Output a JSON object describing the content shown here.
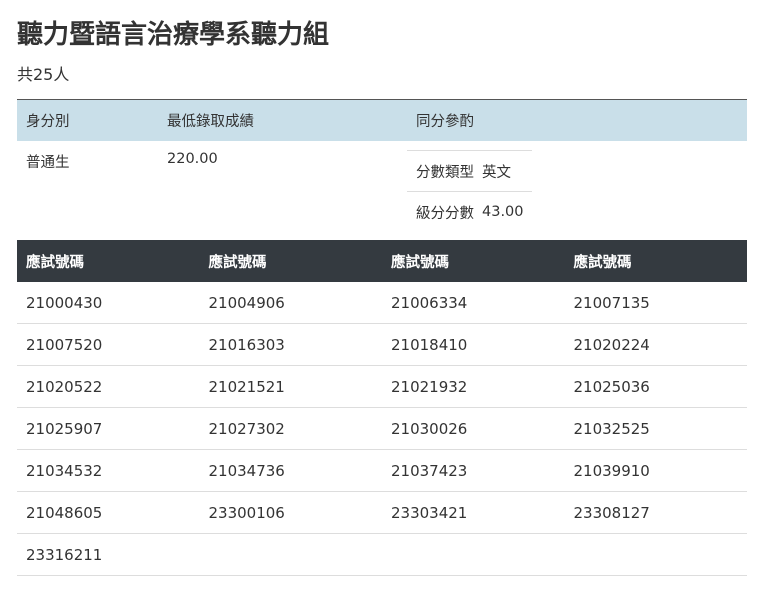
{
  "page_title": "聽力暨語言治療學系聽力組",
  "count_text": "共25人",
  "summary": {
    "headers": [
      "身分別",
      "最低錄取成績",
      "同分參酌"
    ],
    "identity": "普通生",
    "min_score": "220.00",
    "tiebreak": [
      {
        "label": "分數類型",
        "value": "英文"
      },
      {
        "label": "級分分數",
        "value": "43.00"
      }
    ]
  },
  "ids_table": {
    "headers": [
      "應試號碼",
      "應試號碼",
      "應試號碼",
      "應試號碼"
    ],
    "rows": [
      [
        "21000430",
        "21004906",
        "21006334",
        "21007135"
      ],
      [
        "21007520",
        "21016303",
        "21018410",
        "21020224"
      ],
      [
        "21020522",
        "21021521",
        "21021932",
        "21025036"
      ],
      [
        "21025907",
        "21027302",
        "21030026",
        "21032525"
      ],
      [
        "21034532",
        "21034736",
        "21037423",
        "21039910"
      ],
      [
        "21048605",
        "23300106",
        "23303421",
        "23308127"
      ],
      [
        "23316211",
        "",
        "",
        ""
      ]
    ]
  }
}
